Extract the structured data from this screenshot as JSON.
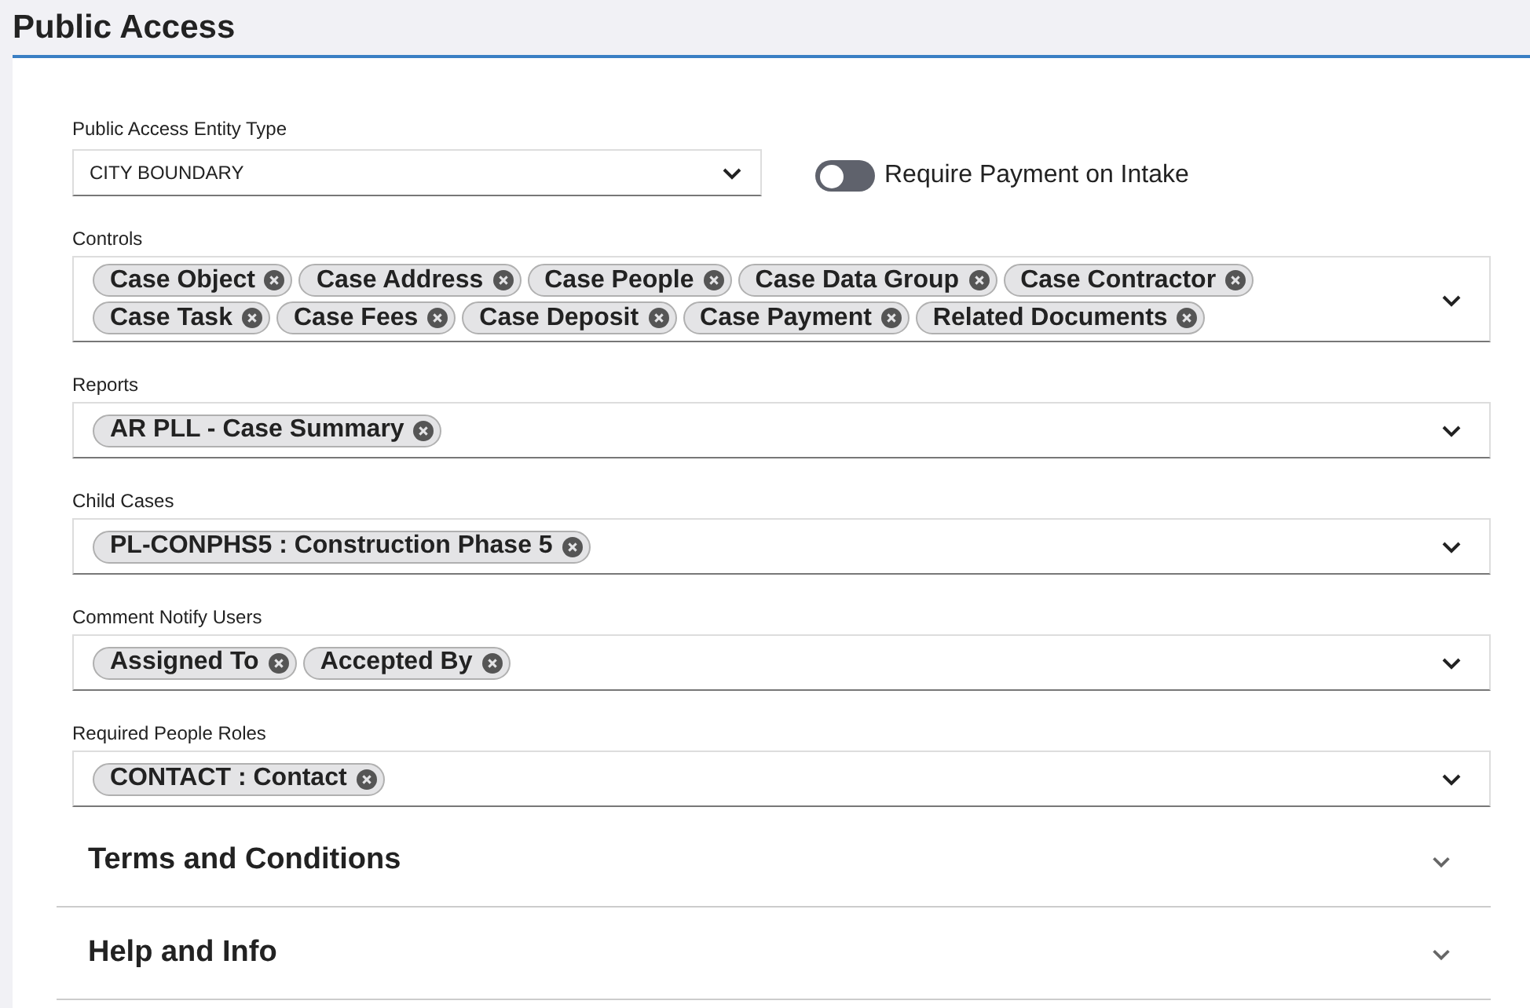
{
  "header": {
    "title": "Public Access"
  },
  "entity_type": {
    "label": "Public Access Entity Type",
    "value": "CITY BOUNDARY"
  },
  "payment_toggle": {
    "label": "Require Payment on Intake",
    "on": false
  },
  "multiselects": [
    {
      "label": "Controls",
      "chips": [
        "Case Object",
        "Case Address",
        "Case People",
        "Case Data Group",
        "Case Contractor",
        "Case Task",
        "Case Fees",
        "Case Deposit",
        "Case Payment",
        "Related Documents"
      ]
    },
    {
      "label": "Reports",
      "chips": [
        "AR PLL - Case Summary"
      ]
    },
    {
      "label": "Child Cases",
      "chips": [
        "PL-CONPHS5 : Construction Phase 5"
      ]
    },
    {
      "label": "Comment Notify Users",
      "chips": [
        "Assigned To",
        "Accepted By"
      ]
    },
    {
      "label": "Required People Roles",
      "chips": [
        "CONTACT : Contact"
      ]
    }
  ],
  "sections": [
    {
      "title": "Terms and Conditions"
    },
    {
      "title": "Help and Info"
    }
  ]
}
